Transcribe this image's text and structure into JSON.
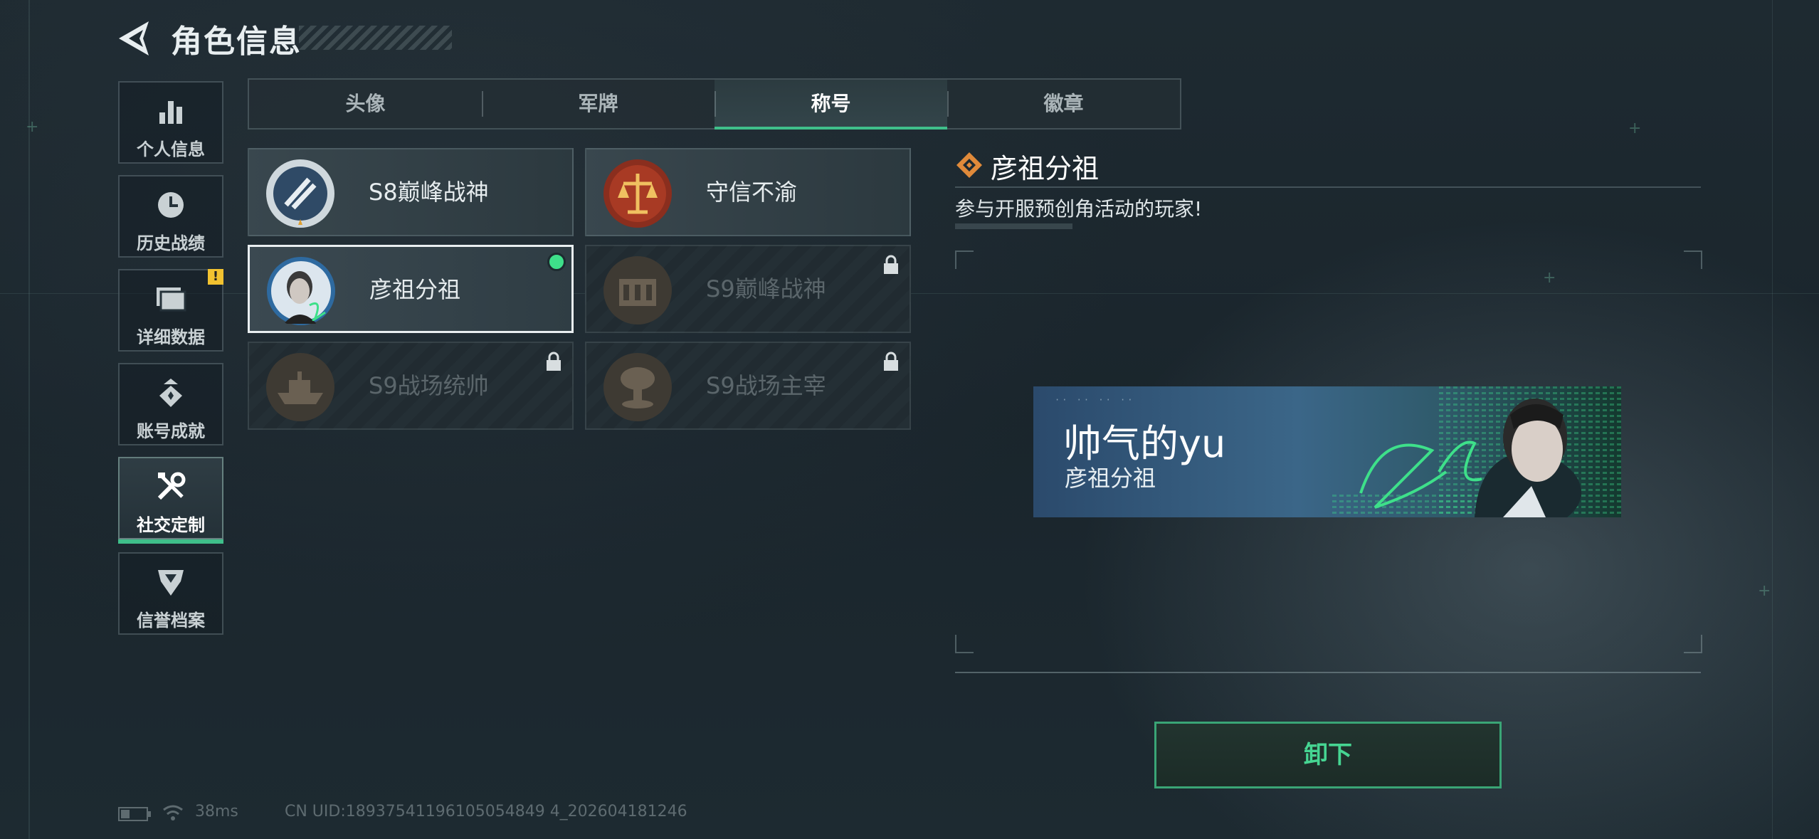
{
  "header": {
    "title": "角色信息"
  },
  "sidebar": {
    "items": [
      {
        "label": "个人信息",
        "icon": "bar-chart-icon"
      },
      {
        "label": "历史战绩",
        "icon": "clock-icon"
      },
      {
        "label": "详细数据",
        "icon": "folder-icon",
        "badge": "!"
      },
      {
        "label": "账号成就",
        "icon": "medal-icon"
      },
      {
        "label": "社交定制",
        "icon": "tools-icon",
        "active": true
      },
      {
        "label": "信誉档案",
        "icon": "shield-icon"
      }
    ]
  },
  "tabs": [
    {
      "label": "头像"
    },
    {
      "label": "军牌"
    },
    {
      "label": "称号",
      "active": true
    },
    {
      "label": "徽章"
    }
  ],
  "titles": [
    {
      "name": "S8巅峰战神",
      "locked": false
    },
    {
      "name": "守信不渝",
      "locked": false
    },
    {
      "name": "彦祖分祖",
      "locked": false,
      "selected": true,
      "equipped": true
    },
    {
      "name": "S9巅峰战神",
      "locked": true
    },
    {
      "name": "S9战场统帅",
      "locked": true
    },
    {
      "name": "S9战场主宰",
      "locked": true
    }
  ],
  "detail": {
    "title": "彦祖分祖",
    "description": "参与开服预创角活动的玩家!"
  },
  "banner": {
    "player_name": "帅气的yu",
    "title": "彦祖分祖"
  },
  "actions": {
    "unequip_label": "卸下"
  },
  "status_bar": {
    "ping": "38ms",
    "uid": "CN UID:18937541196105054849 4_202604181246"
  },
  "colors": {
    "accent": "#3fbf8a",
    "equipped_dot": "#3ee08a",
    "warning": "#f2c230",
    "detail_icon": "#e08a3a"
  }
}
